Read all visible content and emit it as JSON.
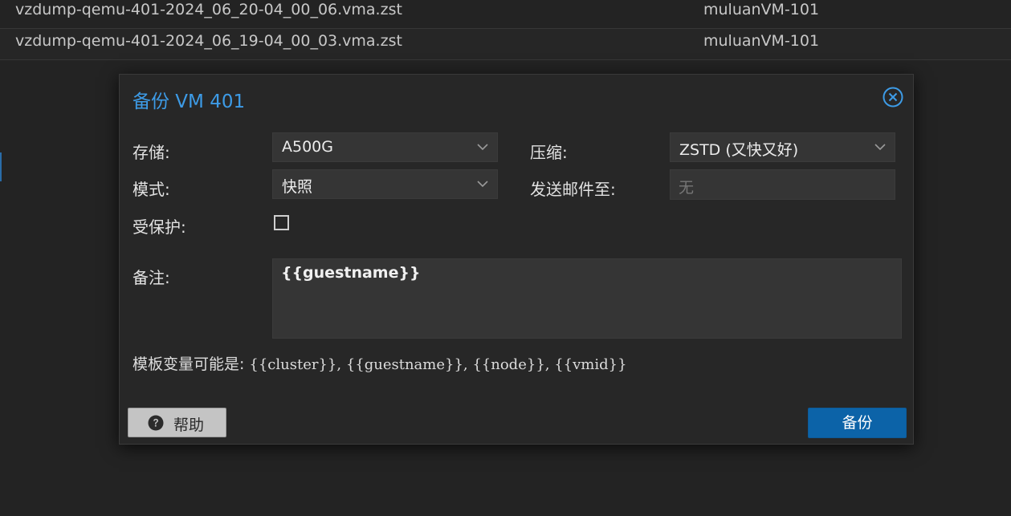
{
  "background_list": {
    "rows": [
      {
        "name": "vzdump-qemu-401-2024_06_20-04_00_06.vma.zst",
        "notes": "muluanVM-101"
      },
      {
        "name": "vzdump-qemu-401-2024_06_19-04_00_03.vma.zst",
        "notes": "muluanVM-101"
      }
    ]
  },
  "dialog": {
    "title": "备份 VM 401",
    "close_icon": "close-circle-icon",
    "fields": {
      "storage": {
        "label": "存储:",
        "value": "A500G"
      },
      "compression": {
        "label": "压缩:",
        "value": "ZSTD (又快又好)"
      },
      "mode": {
        "label": "模式:",
        "value": "快照"
      },
      "mailto": {
        "label": "发送邮件至:",
        "placeholder": "无"
      },
      "protected": {
        "label": "受保护:",
        "checked": false
      },
      "notes": {
        "label": "备注:",
        "value": "{{guestname}}"
      }
    },
    "hint": {
      "label": "模板变量可能是:",
      "vars": "{{cluster}}, {{guestname}}, {{node}}, {{vmid}}"
    },
    "buttons": {
      "help_label": "帮助",
      "backup_label": "备份"
    }
  },
  "colors": {
    "title": "#3d9be6",
    "primary_button": "#0c63a8"
  }
}
